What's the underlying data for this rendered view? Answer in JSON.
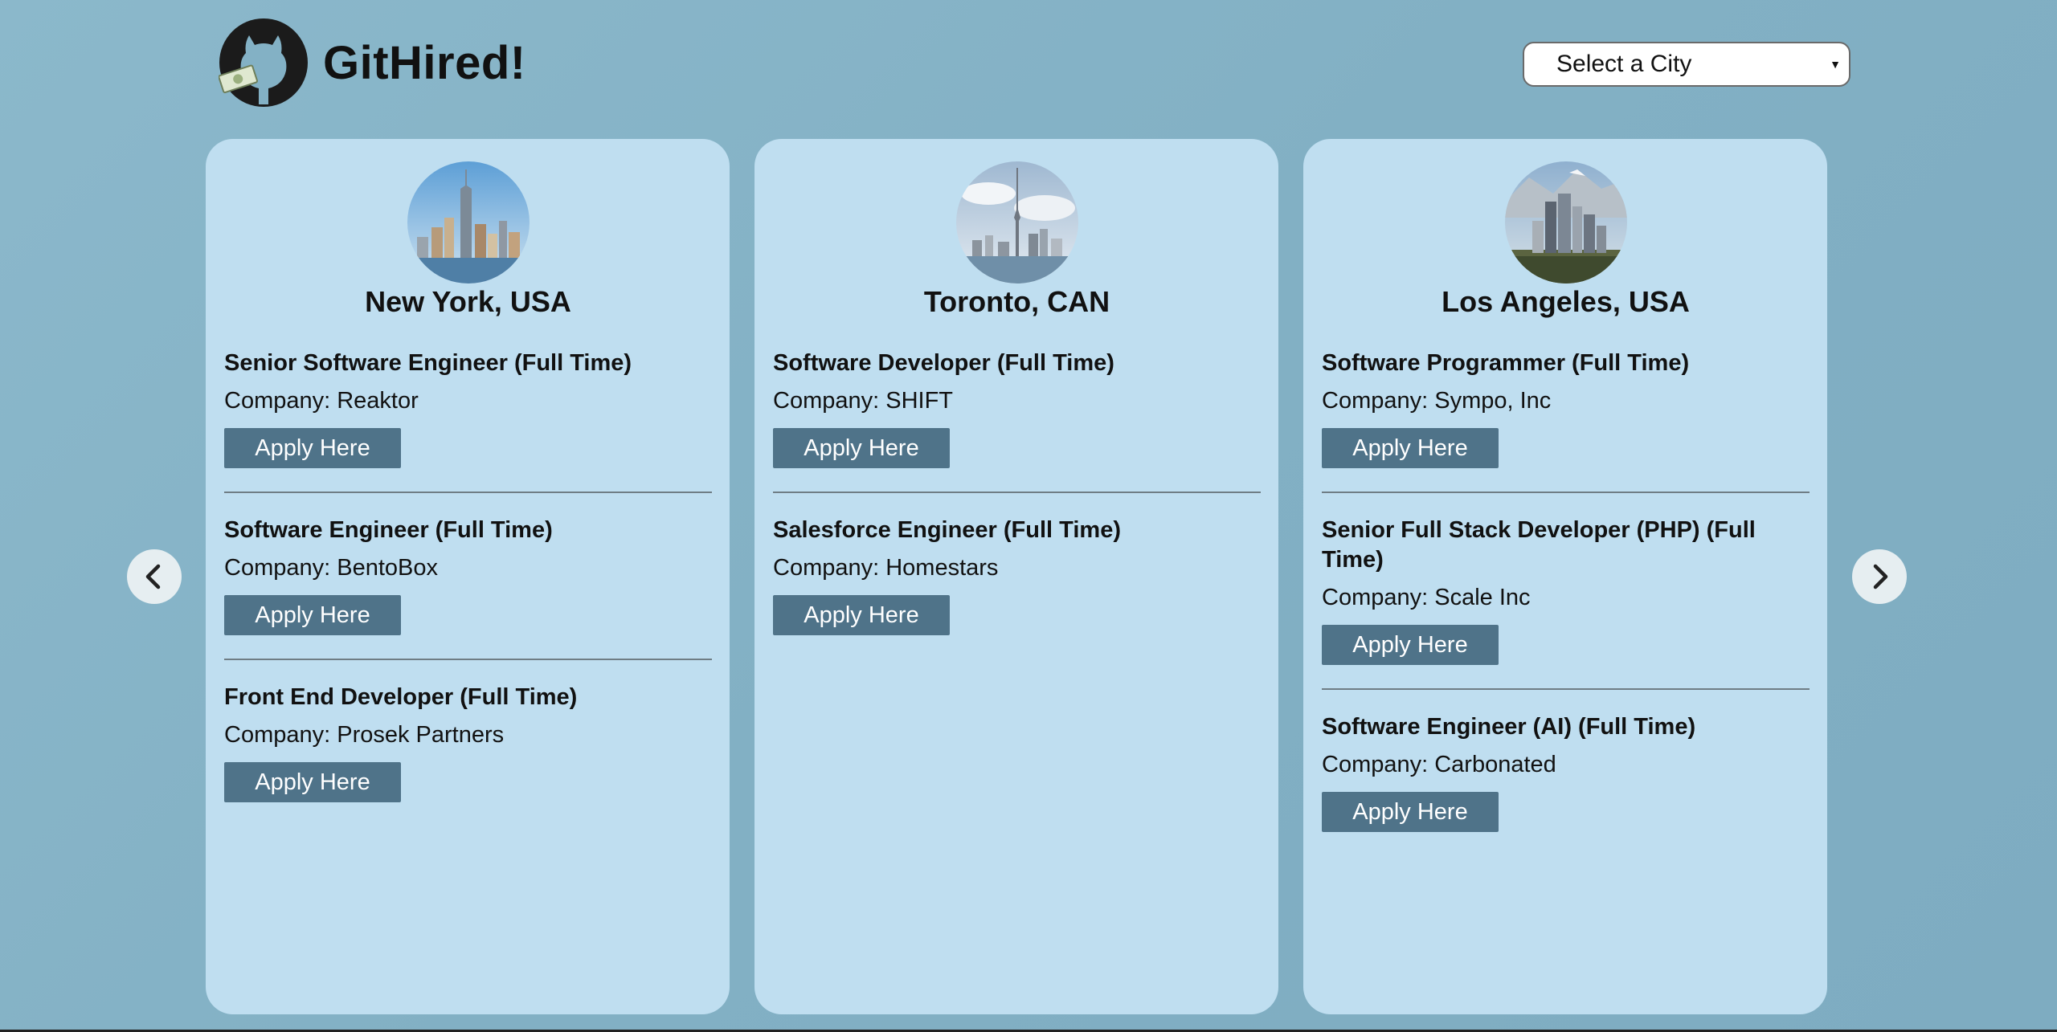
{
  "header": {
    "brand": "GitHired!",
    "city_select": {
      "selected": "Select a City"
    }
  },
  "carousel": {
    "prev_icon": "chevron-left-icon",
    "next_icon": "chevron-right-icon"
  },
  "cards": [
    {
      "city": "New York, USA",
      "jobs": [
        {
          "title": "Senior Software Engineer (Full Time)",
          "company": "Company: Reaktor",
          "apply": "Apply Here"
        },
        {
          "title": "Software Engineer (Full Time)",
          "company": "Company: BentoBox",
          "apply": "Apply Here"
        },
        {
          "title": "Front End Developer (Full Time)",
          "company": "Company: Prosek Partners",
          "apply": "Apply Here"
        }
      ]
    },
    {
      "city": "Toronto, CAN",
      "jobs": [
        {
          "title": "Software Developer (Full Time)",
          "company": "Company: SHIFT",
          "apply": "Apply Here"
        },
        {
          "title": "Salesforce Engineer (Full Time)",
          "company": "Company: Homestars",
          "apply": "Apply Here"
        }
      ]
    },
    {
      "city": "Los Angeles, USA",
      "jobs": [
        {
          "title": "Software Programmer (Full Time)",
          "company": "Company: Sympo, Inc",
          "apply": "Apply Here"
        },
        {
          "title": "Senior Full Stack Developer (PHP) (Full Time)",
          "company": "Company: Scale Inc",
          "apply": "Apply Here"
        },
        {
          "title": "Software Engineer (AI) (Full Time)",
          "company": "Company: Carbonated",
          "apply": "Apply Here"
        }
      ]
    }
  ],
  "colors": {
    "background": "#85b3c7",
    "card": "#bfdef0",
    "button": "#4f7389"
  }
}
